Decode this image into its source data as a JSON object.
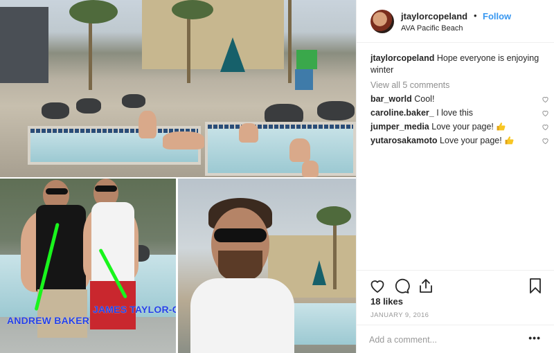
{
  "post": {
    "username": "jtaylorcopeland",
    "dot": "•",
    "follow_label": "Follow",
    "location": "AVA Pacific Beach",
    "caption_user": "jtaylorcopeland",
    "caption_text": "Hope everyone is enjoying winter",
    "view_all": "View all 5 comments",
    "comments": [
      {
        "user": "bar_world",
        "text": "Cool!",
        "emoji": false
      },
      {
        "user": "caroline.baker_",
        "text": "I love this",
        "emoji": false
      },
      {
        "user": "jumper_media",
        "text": "Love your page!",
        "emoji": true
      },
      {
        "user": "yutarosakamoto",
        "text": "Love your page!",
        "emoji": true
      }
    ],
    "likes": "18 likes",
    "date": "JANUARY 9, 2016",
    "add_comment_placeholder": "Add a comment...",
    "more_label": "•••"
  },
  "photo": {
    "label_left": "ANDREW BAKER",
    "label_right": "JAMES TAYLOR-COPELAND"
  },
  "icons": {
    "like": "heart-icon",
    "comment": "comment-bubble-icon",
    "share": "share-upload-icon",
    "save": "bookmark-icon",
    "comment_like": "heart-icon",
    "emoji": "thumbs-up-emoji"
  },
  "colors": {
    "follow": "#3897f0",
    "muted": "#8e8e8e",
    "label": "#2340e6",
    "arrow": "#19f51c"
  }
}
